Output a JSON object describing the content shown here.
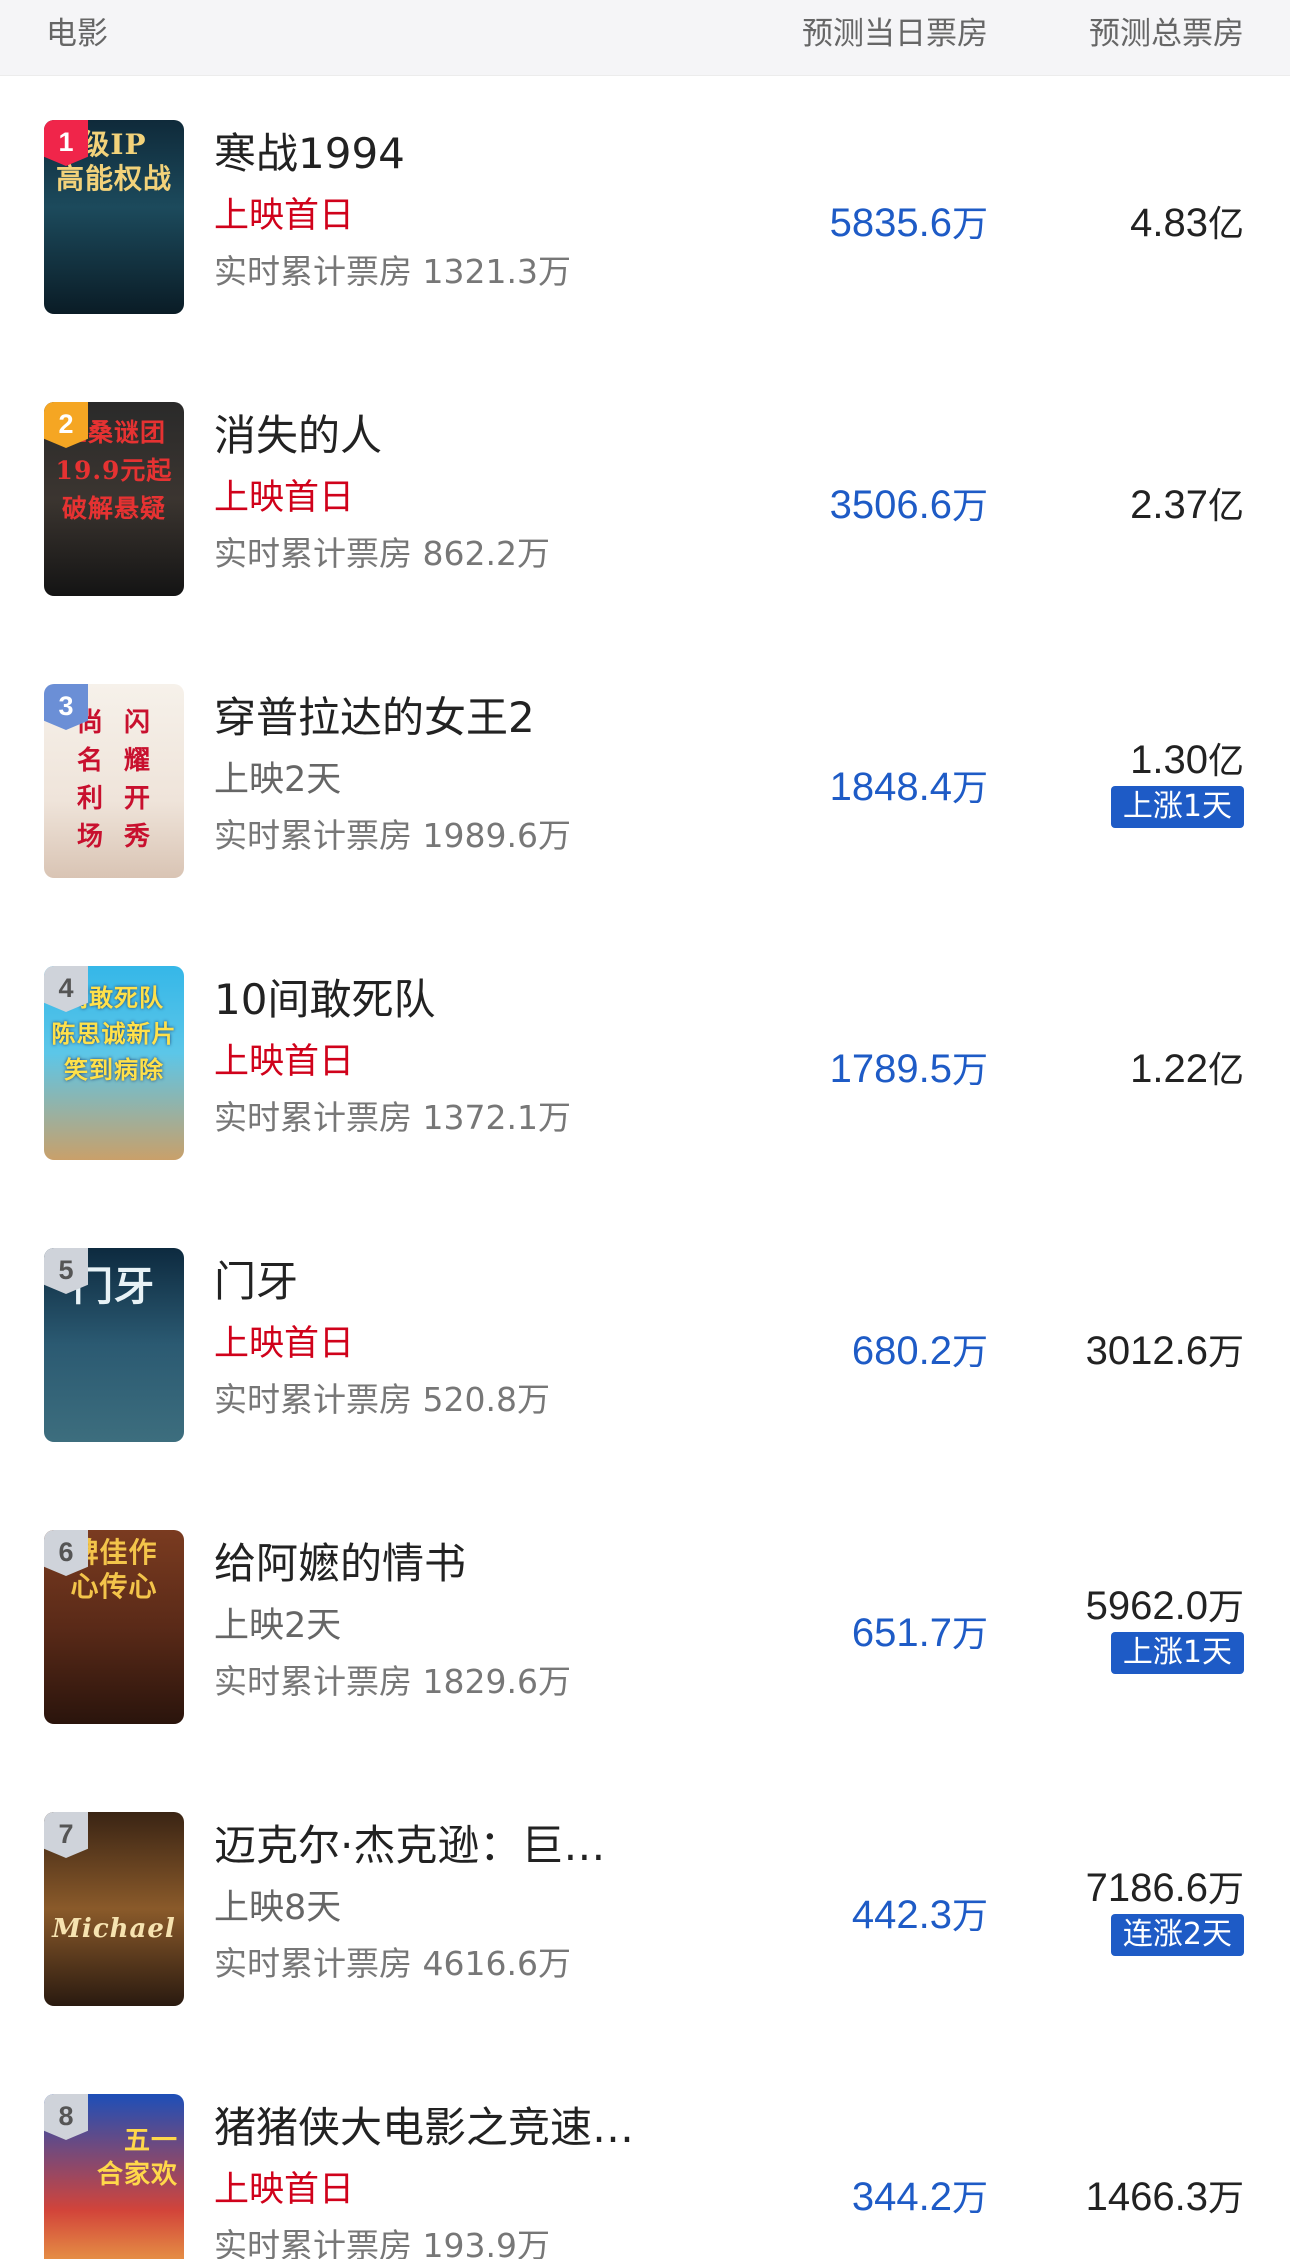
{
  "header": {
    "movie_label": "电影",
    "daily_label": "预测当日票房",
    "total_label": "预测总票房"
  },
  "colors": {
    "accent_blue": "#1e5bc6",
    "first_day_red": "#d0021b"
  },
  "movies": [
    {
      "rank": "1",
      "title": "寒战1994",
      "status": "上映首日",
      "cumulative": "实时累计票房 1321.3万",
      "daily_value": "5835.6",
      "daily_unit": "万",
      "total_value": "4.83",
      "total_unit": "亿",
      "trend": "",
      "poster_text": "级IP\n高能权战"
    },
    {
      "rank": "2",
      "title": "消失的人",
      "status": "上映首日",
      "cumulative": "实时累计票房 862.2万",
      "daily_value": "3506.6",
      "daily_unit": "万",
      "total_value": "2.37",
      "total_unit": "亿",
      "trend": "",
      "poster_text": "三桑谜团\n19.9元起\n破解悬疑"
    },
    {
      "rank": "3",
      "title": "穿普拉达的女王2",
      "status": "上映2天",
      "cumulative": "实时累计票房 1989.6万",
      "daily_value": "1848.4",
      "daily_unit": "万",
      "total_value": "1.30",
      "total_unit": "亿",
      "trend": "上涨1天",
      "poster_text": "尚  闪\n名  耀\n利  开\n场  秀"
    },
    {
      "rank": "4",
      "title": "10间敢死队",
      "status": "上映首日",
      "cumulative": "实时累计票房 1372.1万",
      "daily_value": "1789.5",
      "daily_unit": "万",
      "total_value": "1.22",
      "total_unit": "亿",
      "trend": "",
      "poster_text": "间敢死队\n陈思诚新片\n笑到病除"
    },
    {
      "rank": "5",
      "title": "门牙",
      "status": "上映首日",
      "cumulative": "实时累计票房 520.8万",
      "daily_value": "680.2",
      "daily_unit": "万",
      "total_value": "3012.6",
      "total_unit": "万",
      "trend": "",
      "poster_text": "门牙"
    },
    {
      "rank": "6",
      "title": "给阿嬷的情书",
      "status": "上映2天",
      "cumulative": "实时累计票房 1829.6万",
      "daily_value": "651.7",
      "daily_unit": "万",
      "total_value": "5962.0",
      "total_unit": "万",
      "trend": "上涨1天",
      "poster_text": "碑佳作\n心传心"
    },
    {
      "rank": "7",
      "title": "迈克尔·杰克逊：巨…",
      "status": "上映8天",
      "cumulative": "实时累计票房 4616.6万",
      "daily_value": "442.3",
      "daily_unit": "万",
      "total_value": "7186.6",
      "total_unit": "万",
      "trend": "连涨2天",
      "poster_text": "Michael"
    },
    {
      "rank": "8",
      "title": "猪猪侠大电影之竞速…",
      "status": "上映首日",
      "cumulative": "实时累计票房 193.9万",
      "daily_value": "344.2",
      "daily_unit": "万",
      "total_value": "1466.3",
      "total_unit": "万",
      "trend": "",
      "poster_text": "五一\n合家欢"
    }
  ]
}
